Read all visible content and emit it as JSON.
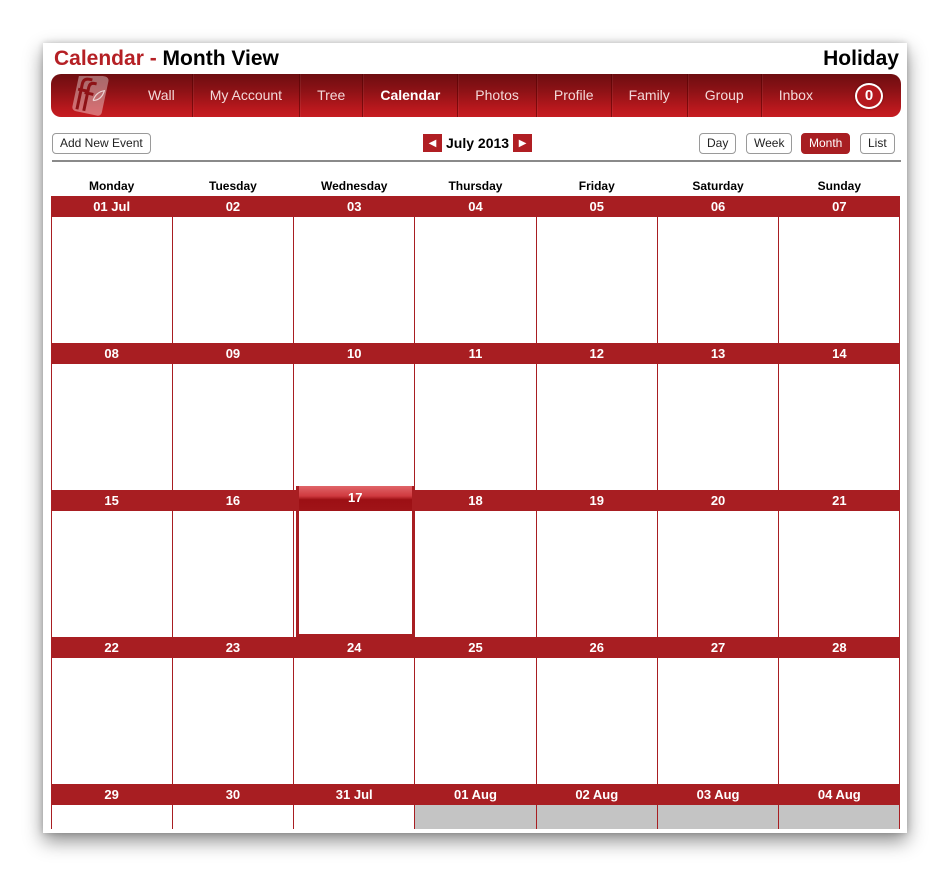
{
  "header": {
    "title_accent": "Calendar -",
    "title_main": "Month View",
    "site_name": "Holiday"
  },
  "nav": {
    "items": [
      {
        "label": "Wall",
        "active": false
      },
      {
        "label": "My Account",
        "active": false
      },
      {
        "label": "Tree",
        "active": false
      },
      {
        "label": "Calendar",
        "active": true
      },
      {
        "label": "Photos",
        "active": false
      },
      {
        "label": "Profile",
        "active": false
      },
      {
        "label": "Family",
        "active": false
      },
      {
        "label": "Group",
        "active": false
      },
      {
        "label": "Inbox",
        "active": false
      }
    ],
    "inbox_count": "0",
    "logo_icon": "family-tree-logo-icon"
  },
  "toolbar": {
    "add_event_label": "Add New Event",
    "month_label": "July 2013",
    "prev_icon": "◀",
    "next_icon": "▶",
    "views": [
      {
        "label": "Day",
        "active": false
      },
      {
        "label": "Week",
        "active": false
      },
      {
        "label": "Month",
        "active": true
      },
      {
        "label": "List",
        "active": false
      }
    ]
  },
  "calendar": {
    "weekdays": [
      "Monday",
      "Tuesday",
      "Wednesday",
      "Thursday",
      "Friday",
      "Saturday",
      "Sunday"
    ],
    "today": "17",
    "weeks": [
      {
        "days": [
          {
            "label": "01 Jul"
          },
          {
            "label": "02"
          },
          {
            "label": "03"
          },
          {
            "label": "04"
          },
          {
            "label": "05"
          },
          {
            "label": "06"
          },
          {
            "label": "07"
          }
        ]
      },
      {
        "days": [
          {
            "label": "08"
          },
          {
            "label": "09"
          },
          {
            "label": "10"
          },
          {
            "label": "11"
          },
          {
            "label": "12"
          },
          {
            "label": "13"
          },
          {
            "label": "14"
          }
        ]
      },
      {
        "days": [
          {
            "label": "15"
          },
          {
            "label": "16"
          },
          {
            "label": "17",
            "today": true
          },
          {
            "label": "18"
          },
          {
            "label": "19"
          },
          {
            "label": "20"
          },
          {
            "label": "21"
          }
        ]
      },
      {
        "days": [
          {
            "label": "22"
          },
          {
            "label": "23"
          },
          {
            "label": "24"
          },
          {
            "label": "25"
          },
          {
            "label": "26"
          },
          {
            "label": "27"
          },
          {
            "label": "28"
          }
        ]
      },
      {
        "days": [
          {
            "label": "29"
          },
          {
            "label": "30"
          },
          {
            "label": "31 Jul"
          },
          {
            "label": "01 Aug",
            "other_month": true
          },
          {
            "label": "02 Aug",
            "other_month": true
          },
          {
            "label": "03 Aug",
            "other_month": true
          },
          {
            "label": "04 Aug",
            "other_month": true
          }
        ]
      }
    ]
  }
}
